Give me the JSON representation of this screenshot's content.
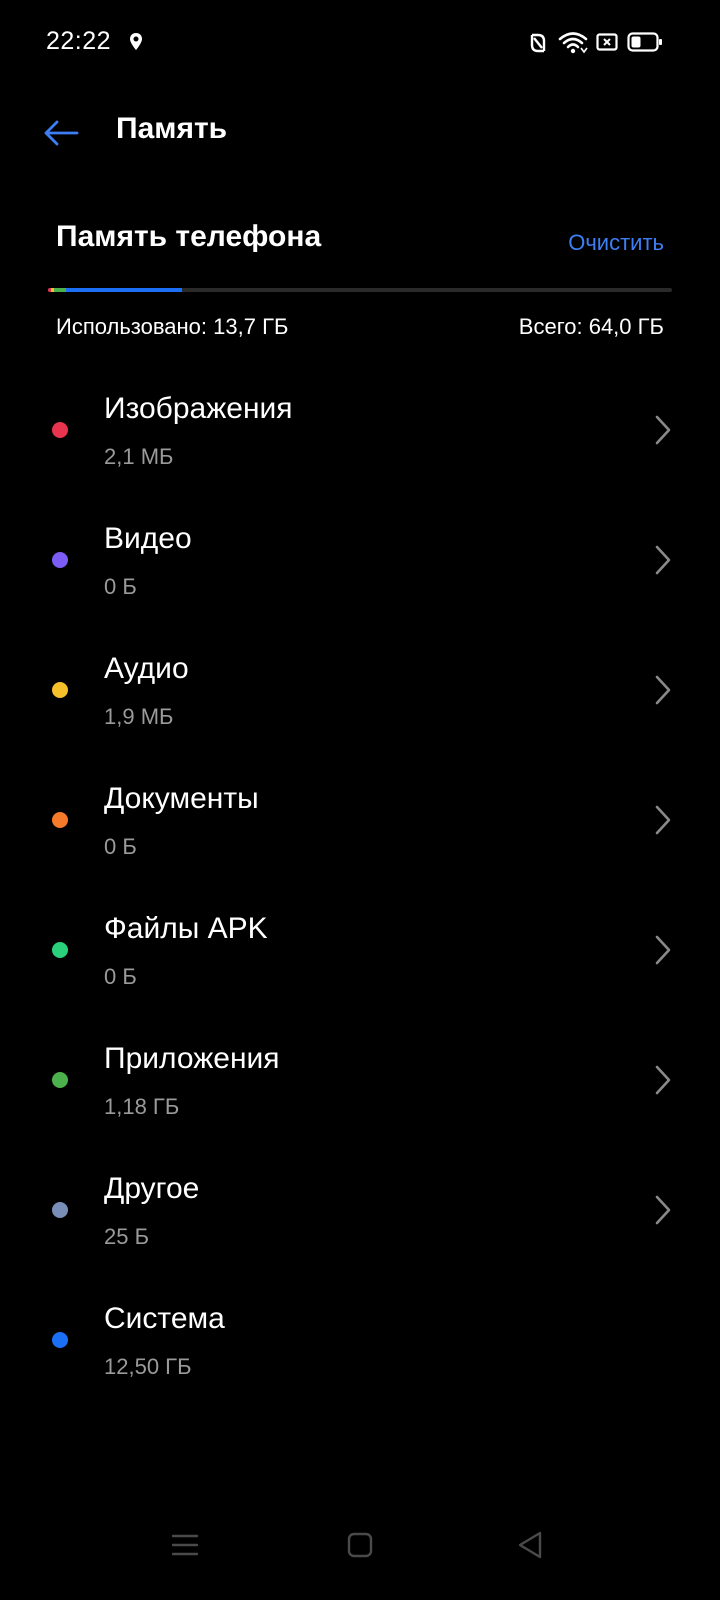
{
  "status_bar": {
    "time": "22:22",
    "icons": [
      "location-icon",
      "nfc-icon",
      "wifi-icon",
      "sim-icon",
      "battery-icon"
    ]
  },
  "header": {
    "back_icon": "arrow-left-icon",
    "title": "Память"
  },
  "storage": {
    "title": "Память телефона",
    "clean_label": "Очистить",
    "used_label": "Использовано: 13,7  ГБ",
    "total_label": "Всего: 64,0 ГБ",
    "used_fraction": 0.214,
    "accent_color": "#3d7ef5"
  },
  "categories": [
    {
      "name": "Изображения",
      "size": "2,1 МБ",
      "color": "#e8344e",
      "has_chevron": true
    },
    {
      "name": "Видео",
      "size": "0 Б",
      "color": "#7b5cf5",
      "has_chevron": true
    },
    {
      "name": "Аудио",
      "size": "1,9 МБ",
      "color": "#f5c02a",
      "has_chevron": true
    },
    {
      "name": "Документы",
      "size": "0 Б",
      "color": "#f57a2a",
      "has_chevron": true
    },
    {
      "name": "Файлы APK",
      "size": "0 Б",
      "color": "#2ad07a",
      "has_chevron": true
    },
    {
      "name": "Приложения",
      "size": "1,18 ГБ",
      "color": "#4cb04c",
      "has_chevron": true
    },
    {
      "name": "Другое",
      "size": "25 Б",
      "color": "#7a8fb8",
      "has_chevron": true
    },
    {
      "name": "Система",
      "size": "12,50  ГБ",
      "color": "#1a6ff5",
      "has_chevron": false
    }
  ],
  "nav_bar": {
    "icons": [
      "menu-icon",
      "home-icon",
      "back-icon"
    ]
  }
}
